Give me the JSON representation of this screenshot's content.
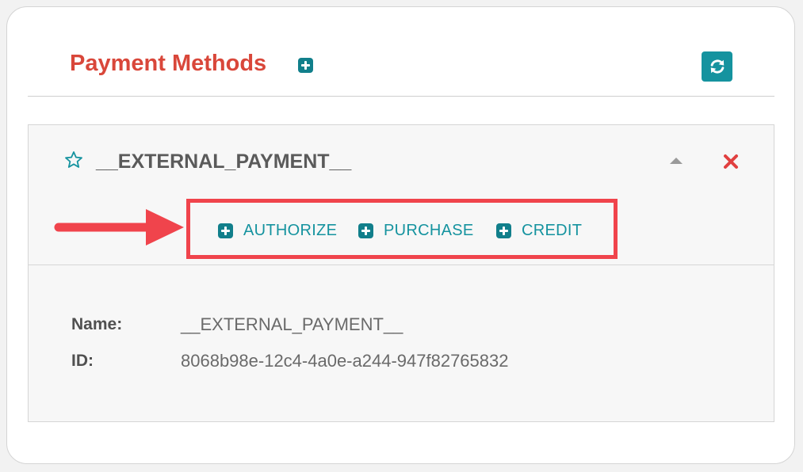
{
  "header": {
    "title": "Payment Methods",
    "title_color": "#d9473a",
    "add_icon": "plus-square-icon",
    "refresh_icon": "refresh-icon",
    "accent_color": "#15939f"
  },
  "payment_method": {
    "name": "__EXTERNAL_PAYMENT__",
    "star_icon": "star-outline-icon",
    "collapse_icon": "caret-up-icon",
    "delete_icon": "close-icon",
    "actions": [
      {
        "label": "AUTHORIZE",
        "icon": "plus-square-icon"
      },
      {
        "label": "PURCHASE",
        "icon": "plus-square-icon"
      },
      {
        "label": "CREDIT",
        "icon": "plus-square-icon"
      }
    ],
    "highlight_color": "#f0444c",
    "details": {
      "name_label": "Name:",
      "name_value": "__EXTERNAL_PAYMENT__",
      "id_label": "ID:",
      "id_value": "8068b98e-12c4-4a0e-a244-947f82765832"
    }
  }
}
